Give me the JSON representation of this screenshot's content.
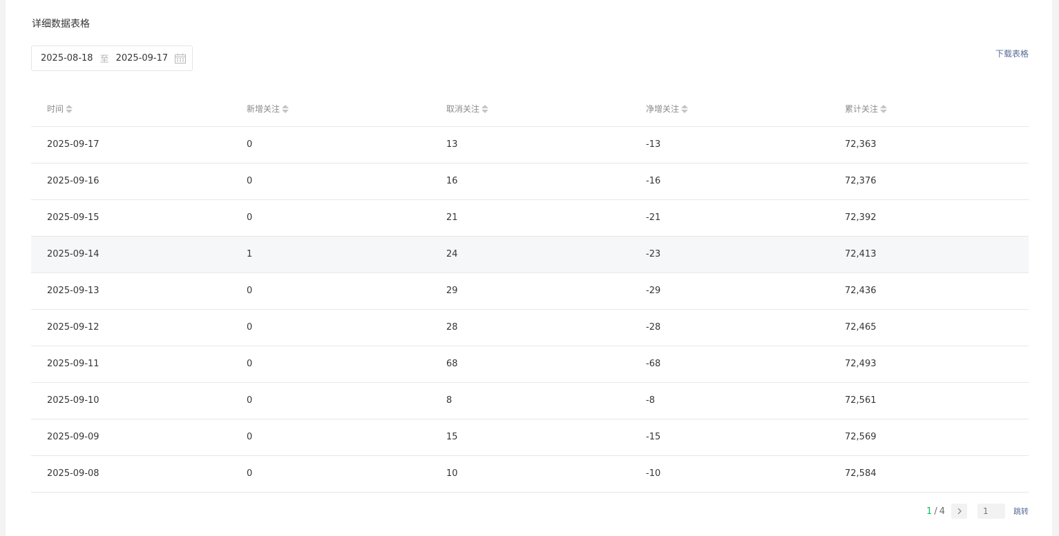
{
  "section_title": "详细数据表格",
  "date_range": {
    "start": "2025-08-18",
    "separator": "至",
    "end": "2025-09-17",
    "icon": "calendar-icon"
  },
  "download_label": "下载表格",
  "table": {
    "headers": [
      "时间",
      "新增关注",
      "取消关注",
      "净增关注",
      "累计关注"
    ],
    "rows": [
      [
        "2025-09-17",
        "0",
        "13",
        "-13",
        "72,363"
      ],
      [
        "2025-09-16",
        "0",
        "16",
        "-16",
        "72,376"
      ],
      [
        "2025-09-15",
        "0",
        "21",
        "-21",
        "72,392"
      ],
      [
        "2025-09-14",
        "1",
        "24",
        "-23",
        "72,413"
      ],
      [
        "2025-09-13",
        "0",
        "29",
        "-29",
        "72,436"
      ],
      [
        "2025-09-12",
        "0",
        "28",
        "-28",
        "72,465"
      ],
      [
        "2025-09-11",
        "0",
        "68",
        "-68",
        "72,493"
      ],
      [
        "2025-09-10",
        "0",
        "8",
        "-8",
        "72,561"
      ],
      [
        "2025-09-09",
        "0",
        "15",
        "-15",
        "72,569"
      ],
      [
        "2025-09-08",
        "0",
        "10",
        "-10",
        "72,584"
      ]
    ],
    "highlighted_row": 3
  },
  "pagination": {
    "current": "1",
    "separator": "/",
    "total": "4",
    "input_placeholder": "1",
    "jump_label": "跳转"
  },
  "colors": {
    "accent": "#07c160",
    "link": "#576b95"
  }
}
